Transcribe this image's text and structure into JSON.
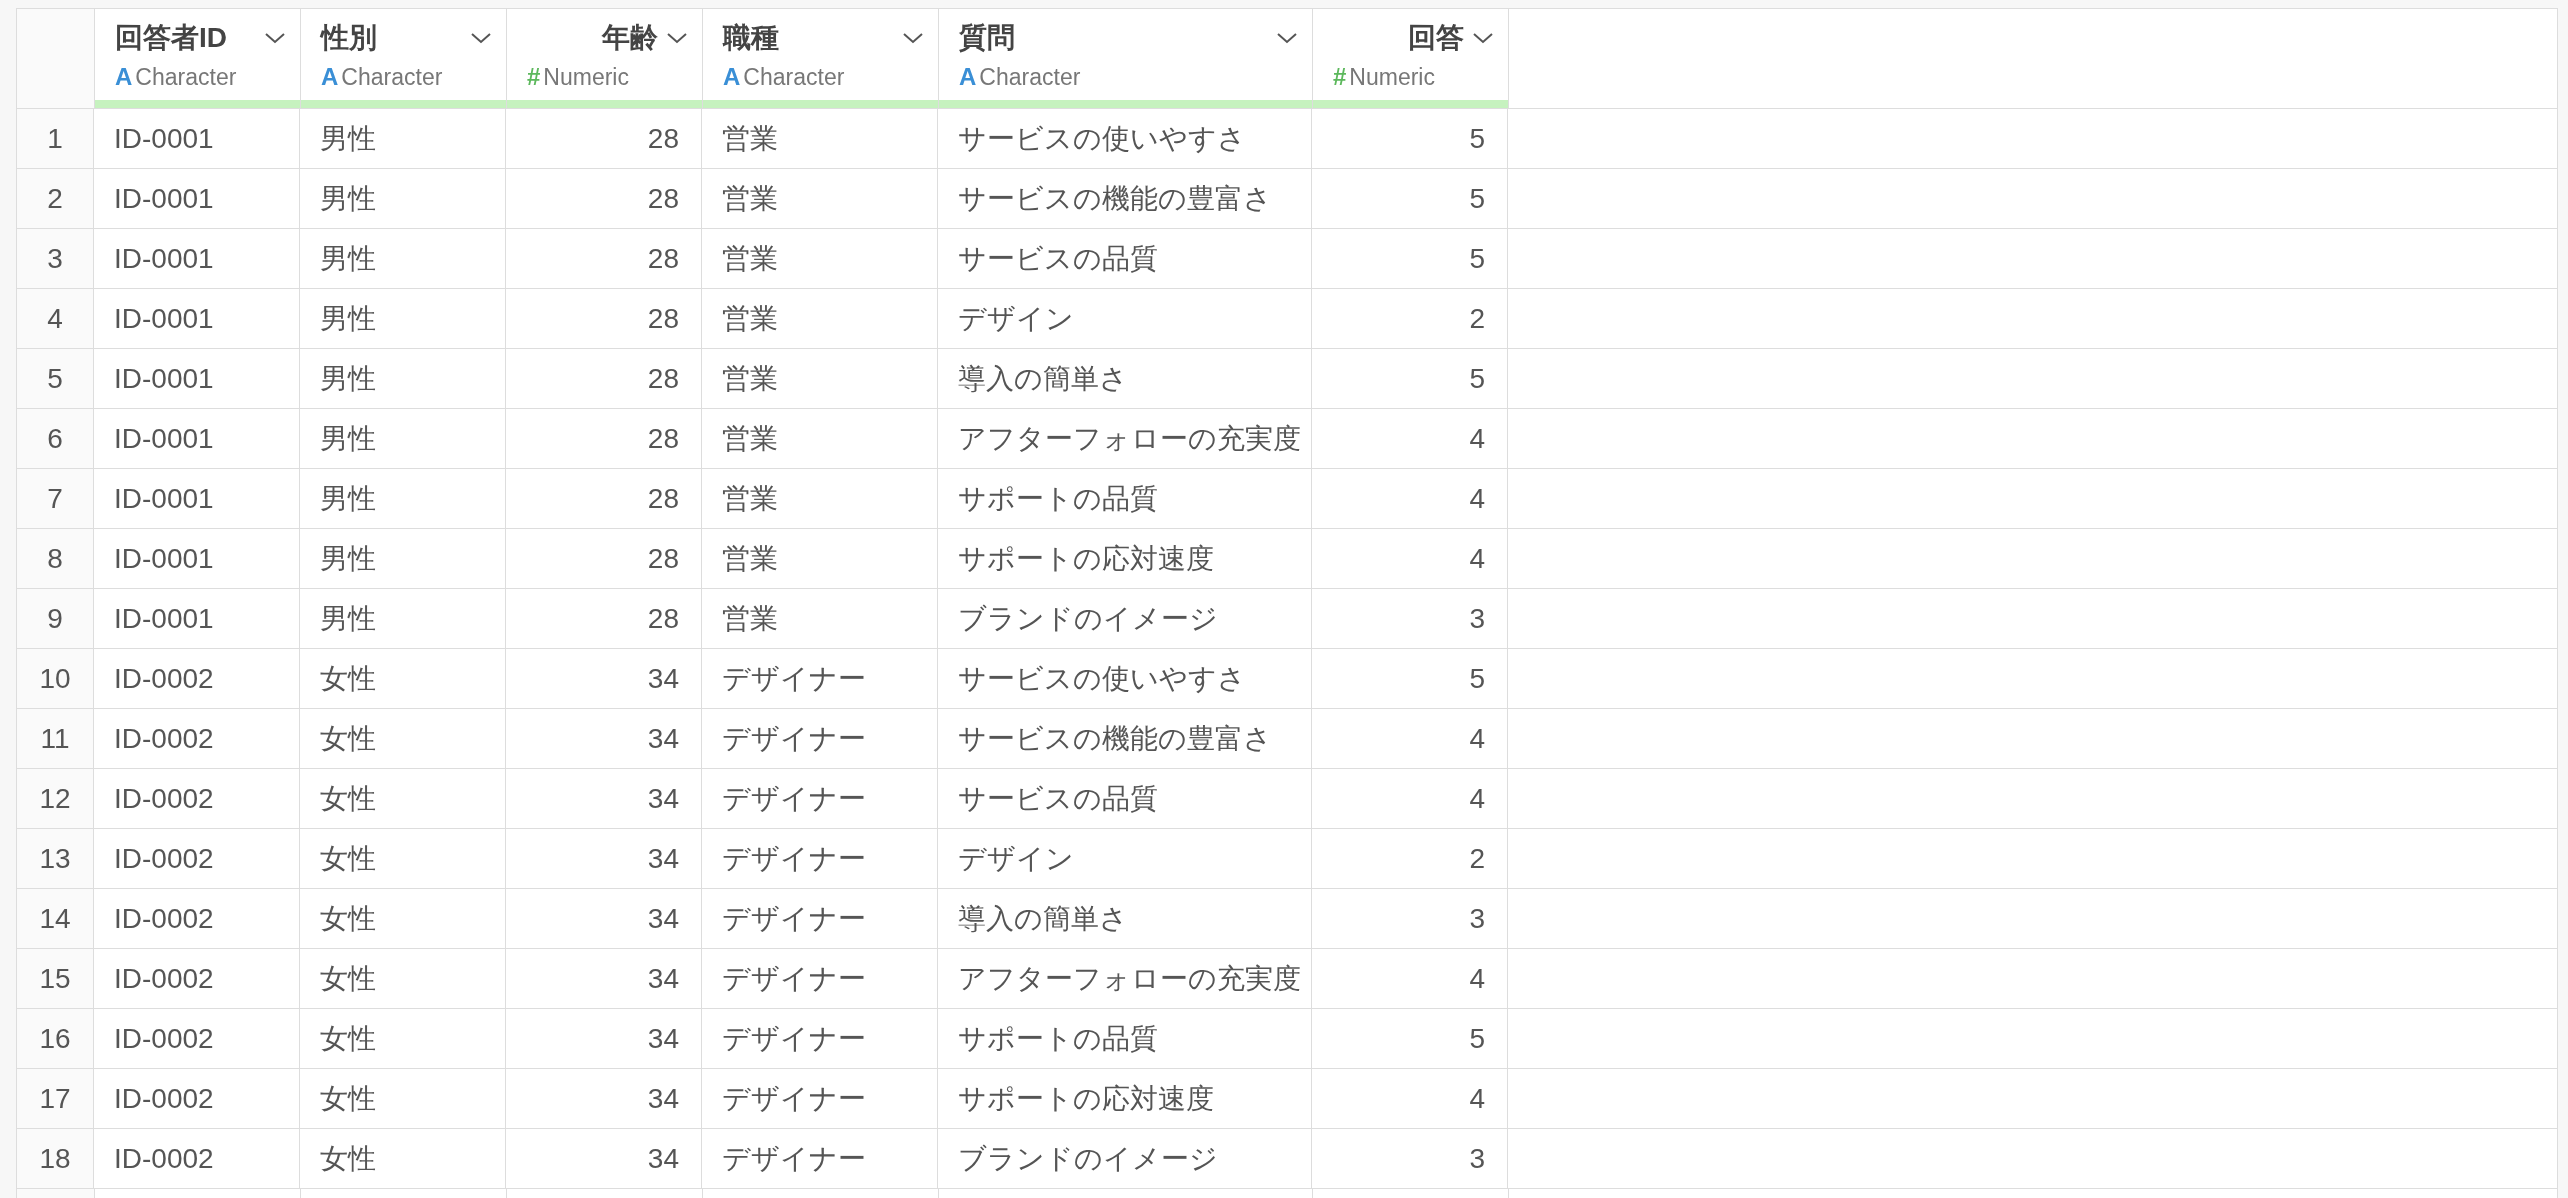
{
  "columns": [
    {
      "name": "回答者ID",
      "kind": "character",
      "type_icon": "A",
      "type": "Character"
    },
    {
      "name": "性別",
      "kind": "character",
      "type_icon": "A",
      "type": "Character"
    },
    {
      "name": "年齢",
      "kind": "numeric",
      "type_icon": "#",
      "type": "Numeric"
    },
    {
      "name": "職種",
      "kind": "character",
      "type_icon": "A",
      "type": "Character"
    },
    {
      "name": "質問",
      "kind": "character",
      "type_icon": "A",
      "type": "Character"
    },
    {
      "name": "回答",
      "kind": "numeric",
      "type_icon": "#",
      "type": "Numeric"
    }
  ],
  "rows": [
    {
      "index": "1",
      "cells": [
        "ID-0001",
        "男性",
        "28",
        "営業",
        "サービスの使いやすさ",
        "5"
      ]
    },
    {
      "index": "2",
      "cells": [
        "ID-0001",
        "男性",
        "28",
        "営業",
        "サービスの機能の豊富さ",
        "5"
      ]
    },
    {
      "index": "3",
      "cells": [
        "ID-0001",
        "男性",
        "28",
        "営業",
        "サービスの品質",
        "5"
      ]
    },
    {
      "index": "4",
      "cells": [
        "ID-0001",
        "男性",
        "28",
        "営業",
        "デザイン",
        "2"
      ]
    },
    {
      "index": "5",
      "cells": [
        "ID-0001",
        "男性",
        "28",
        "営業",
        "導入の簡単さ",
        "5"
      ]
    },
    {
      "index": "6",
      "cells": [
        "ID-0001",
        "男性",
        "28",
        "営業",
        "アフターフォローの充実度",
        "4"
      ]
    },
    {
      "index": "7",
      "cells": [
        "ID-0001",
        "男性",
        "28",
        "営業",
        "サポートの品質",
        "4"
      ]
    },
    {
      "index": "8",
      "cells": [
        "ID-0001",
        "男性",
        "28",
        "営業",
        "サポートの応対速度",
        "4"
      ]
    },
    {
      "index": "9",
      "cells": [
        "ID-0001",
        "男性",
        "28",
        "営業",
        "ブランドのイメージ",
        "3"
      ]
    },
    {
      "index": "10",
      "cells": [
        "ID-0002",
        "女性",
        "34",
        "デザイナー",
        "サービスの使いやすさ",
        "5"
      ]
    },
    {
      "index": "11",
      "cells": [
        "ID-0002",
        "女性",
        "34",
        "デザイナー",
        "サービスの機能の豊富さ",
        "4"
      ]
    },
    {
      "index": "12",
      "cells": [
        "ID-0002",
        "女性",
        "34",
        "デザイナー",
        "サービスの品質",
        "4"
      ]
    },
    {
      "index": "13",
      "cells": [
        "ID-0002",
        "女性",
        "34",
        "デザイナー",
        "デザイン",
        "2"
      ]
    },
    {
      "index": "14",
      "cells": [
        "ID-0002",
        "女性",
        "34",
        "デザイナー",
        "導入の簡単さ",
        "3"
      ]
    },
    {
      "index": "15",
      "cells": [
        "ID-0002",
        "女性",
        "34",
        "デザイナー",
        "アフターフォローの充実度",
        "4"
      ]
    },
    {
      "index": "16",
      "cells": [
        "ID-0002",
        "女性",
        "34",
        "デザイナー",
        "サポートの品質",
        "5"
      ]
    },
    {
      "index": "17",
      "cells": [
        "ID-0002",
        "女性",
        "34",
        "デザイナー",
        "サポートの応対速度",
        "4"
      ]
    },
    {
      "index": "18",
      "cells": [
        "ID-0002",
        "女性",
        "34",
        "デザイナー",
        "ブランドのイメージ",
        "3"
      ]
    }
  ]
}
